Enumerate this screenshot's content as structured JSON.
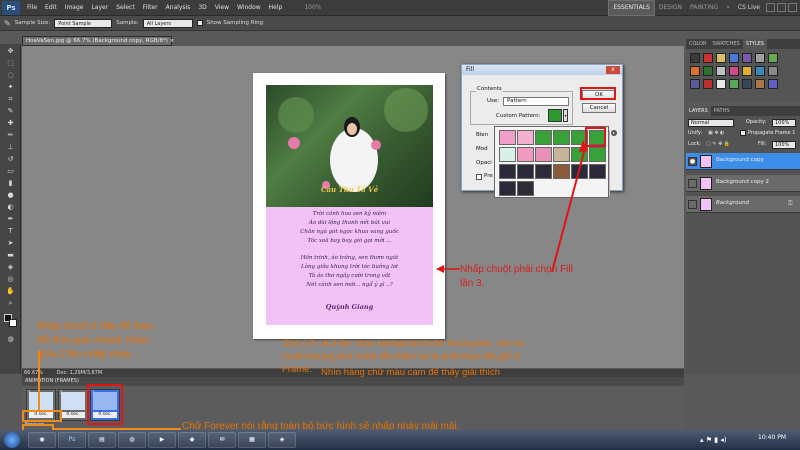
{
  "app": {
    "logo": "Ps"
  },
  "menu": [
    "File",
    "Edit",
    "Image",
    "Layer",
    "Select",
    "Filter",
    "Analysis",
    "3D",
    "View",
    "Window",
    "Help"
  ],
  "zoom_level": "100%",
  "workspaces": {
    "essentials": "ESSENTIALS",
    "design": "DESIGN",
    "painting": "PAINTING",
    "more": "»",
    "cs_live": "CS Live"
  },
  "options": {
    "sample_size_label": "Sample Size:",
    "sample_size_value": "Point Sample",
    "sample_label": "Sample:",
    "sample_value": "All Layers",
    "show_ring_label": "Show Sampling Ring"
  },
  "document": {
    "tab_title": "HoaVaSen.jpg @ 66.7% (Background copy, RGB/8*) ×"
  },
  "poem": {
    "title": "Câu Thơ Tả Vẻ",
    "lines": [
      "Trời cánh hoa sen kỷ niệm ",
      "Áo dài lộng thanh nét bút vui",
      "Chân ngà gót ngọc khua vang guốc",
      "Tóc xoã bay bay gió gọi mời ...",
      "",
      "Hồn trinh, áo trắng, sen thơm ngát",
      "Lòng giữa khung trời tóc buông lơi",
      "Tà áo thơ ngây cười trong vắt",
      "Nét cánh sen mới... ngẩ ý gì ..?"
    ],
    "signature": "Quỳnh Giang"
  },
  "dialog": {
    "title": "Fill",
    "close": "x",
    "contents_label": "Contents",
    "use_label": "Use:",
    "use_value": "Pattern",
    "custom_pattern_label": "Custom Pattern:",
    "blending_label": "Blen",
    "mode_label": "Mod",
    "opacity_label": "Opaci",
    "preserve_label": "Pre",
    "ok": "OK",
    "cancel": "Cancel"
  },
  "panels": {
    "tabs_top": [
      "COLOR",
      "SWATCHES",
      "STYLES"
    ],
    "tabs_layers": [
      "LAYERS",
      "PATHS"
    ],
    "blend_mode": "Normal",
    "opacity_label": "Opacity:",
    "opacity_value": "100%",
    "unify_label": "Unify:",
    "propagate_label": "Propagate Frame 1",
    "lock_label": "Lock:",
    "fill_label": "Fill:",
    "fill_value": "100%",
    "layers": [
      {
        "name": "Background copy",
        "selected": true,
        "visible": true
      },
      {
        "name": "Background copy 2",
        "selected": false,
        "visible": false
      },
      {
        "name": "Background",
        "selected": false,
        "visible": false
      }
    ]
  },
  "status": {
    "zoom": "66.67%",
    "doc": "Doc: 1,29M/3,87M"
  },
  "animation": {
    "tab": "ANIMATION (FRAMES)",
    "loop": "Forever",
    "frames": [
      {
        "n": "1",
        "time": "0 sec."
      },
      {
        "n": "2",
        "time": "0 sec."
      },
      {
        "n": "3",
        "time": "0 sec."
      }
    ]
  },
  "annotations": {
    "fill_note_1": "Nhấp chuột phải chọn Fill",
    "fill_note_2": "lần 3.",
    "time_note_1": "Nhấp chuột ở đây để thay",
    "time_note_2": "đổi thời gian nhanh chậm",
    "time_note_3": "giữa 2 lần nhấp nháy.",
    "bg_note_1": "Chú ý ở cả 3 lần chọn background cho khung ảnh, nếu ta",
    "bg_note_2": "muốn khung ảnh chớp tắt chậm lại ta phải thay đổi giờ ở",
    "bg_note_3": "Frame.",
    "color_note": "Nhìn hàng chữ màu cam để thấy giải thích",
    "forever_note": "Chữ Forever nói rằng toàn bộ bức hình sẽ nhấp nháy mãi mãi."
  },
  "taskbar": {
    "clock": "10:40 PM",
    "items": [
      "",
      "Ps",
      "",
      "",
      "",
      "",
      "",
      "",
      ""
    ]
  },
  "colors": {
    "accent_red": "#e01515",
    "annotation_orange": "#e8730a",
    "pattern_green": "#2e9a2e",
    "poem_bg": "#f2c1f5"
  }
}
